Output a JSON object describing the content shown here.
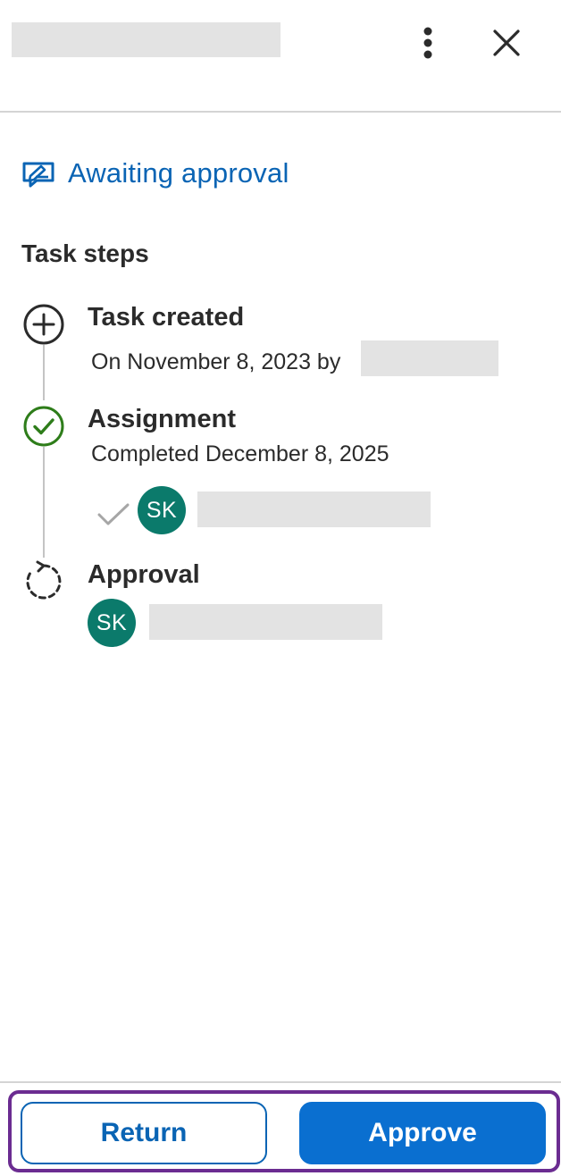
{
  "header": {
    "title_redacted": "",
    "more_icon": "vertical-ellipsis",
    "close_icon": "x-close"
  },
  "status": {
    "icon": "signature-pen",
    "label": "Awaiting approval",
    "color": "#0a64b4"
  },
  "task_steps": {
    "heading": "Task steps",
    "steps": [
      {
        "icon": "plus-circle",
        "title": "Task created",
        "subtitle": "On November 8, 2023 by"
      },
      {
        "icon": "check-circle",
        "title": "Assignment",
        "subtitle": "Completed December 8, 2025",
        "assignee_initials": "SK",
        "assignee_status_icon": "checkmark"
      },
      {
        "icon": "dashed-refresh",
        "title": "Approval",
        "assignee_initials": "SK"
      }
    ]
  },
  "colors": {
    "accent": "#0a64b4",
    "primary_button": "#0a6fd0",
    "success": "#2e7d1a",
    "avatar": "#0b7a6b",
    "focus_ring": "#6b2c91"
  },
  "footer": {
    "return_label": "Return",
    "approve_label": "Approve"
  }
}
